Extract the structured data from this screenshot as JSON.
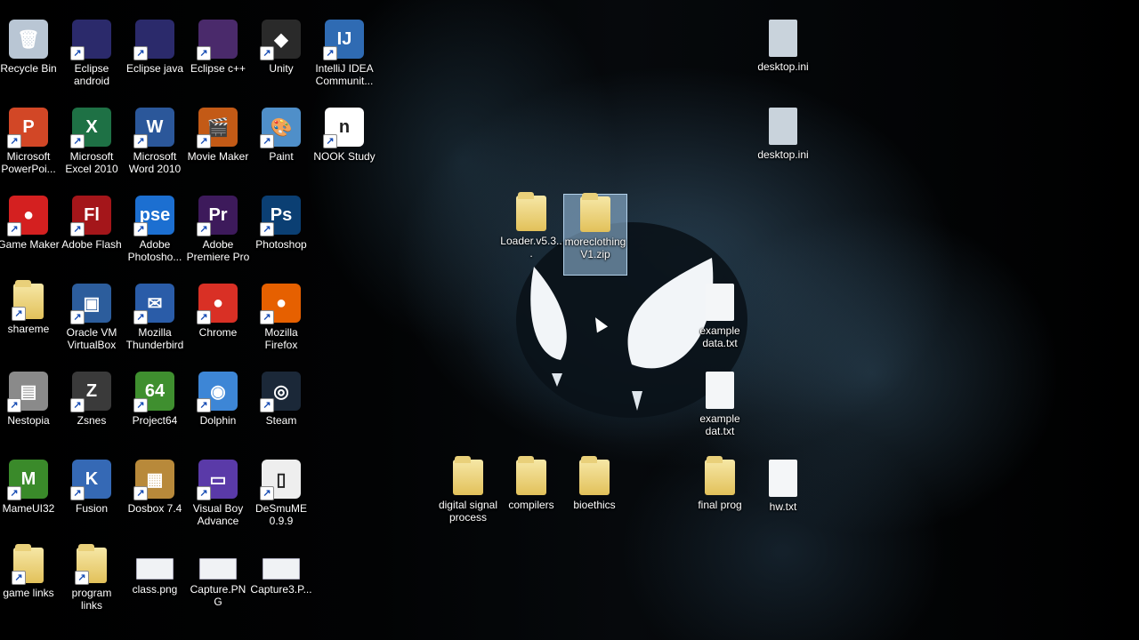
{
  "desktop": {
    "icons": [
      {
        "id": "recycle-bin",
        "label": "Recycle Bin",
        "icon": "recycle-bin-icon",
        "color": "#b9c6d4",
        "glyph": "🗑",
        "shortcut": false
      },
      {
        "id": "eclipse-android",
        "label": "Eclipse android",
        "icon": "eclipse-icon",
        "color": "#2b2a6b",
        "glyph": "",
        "shortcut": true
      },
      {
        "id": "eclipse-java",
        "label": "Eclipse java",
        "icon": "eclipse-icon",
        "color": "#2b2a6b",
        "glyph": "",
        "shortcut": true
      },
      {
        "id": "eclipse-cpp",
        "label": "Eclipse c++",
        "icon": "eclipse-icon",
        "color": "#4a2a6b",
        "glyph": "",
        "shortcut": true
      },
      {
        "id": "unity",
        "label": "Unity",
        "icon": "unity-icon",
        "color": "#2a2a2a",
        "glyph": "◆",
        "shortcut": true
      },
      {
        "id": "intellij",
        "label": "IntelliJ IDEA Communit...",
        "icon": "intellij-icon",
        "color": "#2f6bb3",
        "glyph": "IJ",
        "shortcut": true
      },
      {
        "id": "powerpoint",
        "label": "Microsoft PowerPoi...",
        "icon": "powerpoint-icon",
        "color": "#d24726",
        "glyph": "P",
        "shortcut": true
      },
      {
        "id": "excel",
        "label": "Microsoft Excel 2010",
        "icon": "excel-icon",
        "color": "#1e7145",
        "glyph": "X",
        "shortcut": true
      },
      {
        "id": "word",
        "label": "Microsoft Word 2010",
        "icon": "word-icon",
        "color": "#2b579a",
        "glyph": "W",
        "shortcut": true
      },
      {
        "id": "movie-maker",
        "label": "Movie Maker",
        "icon": "movie-maker-icon",
        "color": "#c35a16",
        "glyph": "🎬",
        "shortcut": true
      },
      {
        "id": "paint",
        "label": "Paint",
        "icon": "paint-icon",
        "color": "#4f8fc9",
        "glyph": "🎨",
        "shortcut": true
      },
      {
        "id": "nook-study",
        "label": "NOOK Study",
        "icon": "nook-icon",
        "color": "#ffffff",
        "glyph": "n",
        "shortcut": true
      },
      {
        "id": "game-maker",
        "label": "Game Maker",
        "icon": "game-maker-icon",
        "color": "#d42020",
        "glyph": "●",
        "shortcut": true
      },
      {
        "id": "adobe-flash",
        "label": "Adobe Flash",
        "icon": "flash-icon",
        "color": "#a4161a",
        "glyph": "Fl",
        "shortcut": true
      },
      {
        "id": "adobe-photoshop-elements",
        "label": "Adobe Photosho...",
        "icon": "photoshop-elements-icon",
        "color": "#1c6fd1",
        "glyph": "pse",
        "shortcut": true
      },
      {
        "id": "premiere-pro",
        "label": "Adobe Premiere Pro",
        "icon": "premiere-icon",
        "color": "#3d1a5b",
        "glyph": "Pr",
        "shortcut": true
      },
      {
        "id": "photoshop",
        "label": "Photoshop",
        "icon": "photoshop-icon",
        "color": "#0b3f73",
        "glyph": "Ps",
        "shortcut": true
      },
      {
        "id": "shareme",
        "label": "shareme",
        "icon": "folder-icon",
        "color": "#e8cf78",
        "glyph": "",
        "shortcut": true,
        "type": "folder"
      },
      {
        "id": "virtualbox",
        "label": "Oracle VM VirtualBox",
        "icon": "virtualbox-icon",
        "color": "#2c5d9c",
        "glyph": "▣",
        "shortcut": true
      },
      {
        "id": "thunderbird",
        "label": "Mozilla Thunderbird",
        "icon": "thunderbird-icon",
        "color": "#2a5ca8",
        "glyph": "✉",
        "shortcut": true
      },
      {
        "id": "chrome",
        "label": "Chrome",
        "icon": "chrome-icon",
        "color": "#d93025",
        "glyph": "●",
        "shortcut": true
      },
      {
        "id": "firefox",
        "label": "Mozilla Firefox",
        "icon": "firefox-icon",
        "color": "#e66000",
        "glyph": "●",
        "shortcut": true
      },
      {
        "id": "nestopia",
        "label": "Nestopia",
        "icon": "nestopia-icon",
        "color": "#8a8a8a",
        "glyph": "▤",
        "shortcut": true
      },
      {
        "id": "zsnes",
        "label": "Zsnes",
        "icon": "zsnes-icon",
        "color": "#3a3a3a",
        "glyph": "Z",
        "shortcut": true
      },
      {
        "id": "project64",
        "label": "Project64",
        "icon": "project64-icon",
        "color": "#3f8f2f",
        "glyph": "64",
        "shortcut": true
      },
      {
        "id": "dolphin",
        "label": "Dolphin",
        "icon": "dolphin-icon",
        "color": "#3d86d6",
        "glyph": "◉",
        "shortcut": true
      },
      {
        "id": "steam",
        "label": "Steam",
        "icon": "steam-icon",
        "color": "#1b2838",
        "glyph": "◎",
        "shortcut": true
      },
      {
        "id": "mameui32",
        "label": "MameUI32",
        "icon": "mame-icon",
        "color": "#3a8a2a",
        "glyph": "M",
        "shortcut": true
      },
      {
        "id": "fusion",
        "label": "Fusion",
        "icon": "fusion-icon",
        "color": "#3569b5",
        "glyph": "K",
        "shortcut": true
      },
      {
        "id": "dosbox",
        "label": "Dosbox 7.4",
        "icon": "dosbox-icon",
        "color": "#b8893a",
        "glyph": "▦",
        "shortcut": true
      },
      {
        "id": "visual-boy",
        "label": "Visual Boy Advance",
        "icon": "visual-boy-icon",
        "color": "#5a3aa8",
        "glyph": "▭",
        "shortcut": true
      },
      {
        "id": "desmume",
        "label": "DeSmuME 0.9.9",
        "icon": "desmume-icon",
        "color": "#eeeeee",
        "glyph": "▯",
        "shortcut": true
      },
      {
        "id": "game-links",
        "label": "game links",
        "icon": "folder-icon",
        "color": "#e8cf78",
        "glyph": "",
        "shortcut": true,
        "type": "folder"
      },
      {
        "id": "program-links",
        "label": "program links",
        "icon": "folder-icon",
        "color": "#e8cf78",
        "glyph": "",
        "shortcut": true,
        "type": "folder"
      },
      {
        "id": "class-png",
        "label": "class.png",
        "icon": "image-thumbnail-icon",
        "color": "#f0f2f5",
        "glyph": "",
        "shortcut": false,
        "type": "thumb"
      },
      {
        "id": "capture-png",
        "label": "Capture.PNG",
        "icon": "image-thumbnail-icon",
        "color": "#f0f2f5",
        "glyph": "",
        "shortcut": false,
        "type": "thumb"
      },
      {
        "id": "capture3-png",
        "label": "Capture3.P...",
        "icon": "image-thumbnail-icon",
        "color": "#f0f2f5",
        "glyph": "",
        "shortcut": false,
        "type": "thumb"
      },
      {
        "id": "desktop-ini-1",
        "label": "desktop.ini",
        "icon": "settings-file-icon",
        "color": "#c9d3dc",
        "glyph": "",
        "shortcut": false,
        "type": "ini"
      },
      {
        "id": "desktop-ini-2",
        "label": "desktop.ini",
        "icon": "settings-file-icon",
        "color": "#c9d3dc",
        "glyph": "",
        "shortcut": false,
        "type": "ini"
      },
      {
        "id": "loader-zip",
        "label": "Loader.v5.3...",
        "icon": "zip-folder-icon",
        "color": "#e8cf78",
        "glyph": "",
        "shortcut": false,
        "type": "folder"
      },
      {
        "id": "moreclothing-zip",
        "label": "moreclothingV1.zip",
        "icon": "zip-folder-icon",
        "color": "#e8cf78",
        "glyph": "",
        "shortcut": false,
        "type": "folder",
        "selected": true
      },
      {
        "id": "example-data-txt",
        "label": "example data.txt",
        "icon": "text-file-icon",
        "color": "#f4f6f8",
        "glyph": "",
        "shortcut": false,
        "type": "doc"
      },
      {
        "id": "example-dat-txt",
        "label": "example dat.txt",
        "icon": "text-file-icon",
        "color": "#f4f6f8",
        "glyph": "",
        "shortcut": false,
        "type": "doc"
      },
      {
        "id": "digital-signal",
        "label": "digital signal process",
        "icon": "folder-icon",
        "color": "#e8cf78",
        "glyph": "",
        "shortcut": false,
        "type": "folder"
      },
      {
        "id": "compilers",
        "label": "compilers",
        "icon": "folder-icon",
        "color": "#e8cf78",
        "glyph": "",
        "shortcut": false,
        "type": "folder"
      },
      {
        "id": "bioethics",
        "label": "bioethics",
        "icon": "folder-icon",
        "color": "#e8cf78",
        "glyph": "",
        "shortcut": false,
        "type": "folder"
      },
      {
        "id": "final-prog",
        "label": "final prog",
        "icon": "folder-icon",
        "color": "#e8cf78",
        "glyph": "",
        "shortcut": false,
        "type": "folder"
      },
      {
        "id": "hw-txt",
        "label": "hw.txt",
        "icon": "text-file-icon",
        "color": "#f4f6f8",
        "glyph": "",
        "shortcut": false,
        "type": "doc"
      }
    ]
  }
}
